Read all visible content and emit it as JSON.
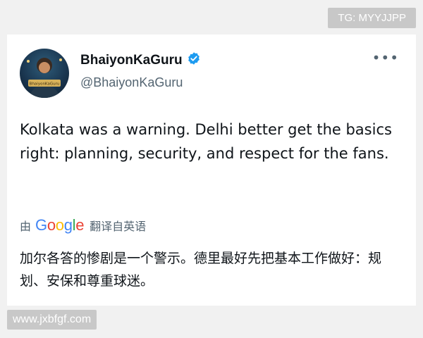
{
  "watermark_top": "TG: MYYJJPP",
  "watermark_bottom": "www.jxbfgf.com",
  "tweet": {
    "display_name": "BhaiyonKaGuru",
    "handle": "@BhaiyonKaGuru",
    "more_label": "•••",
    "text": "Kolkata was a warning. Delhi better get the basics right: planning, security, and respect for the fans.",
    "avatar_caption": "BhaiyonKaGuru"
  },
  "translation": {
    "by_label": "由",
    "provider": "Google",
    "action_label": "翻译自英语",
    "text": "加尔各答的惨剧是一个警示。德里最好先把基本工作做好：规划、安保和尊重球迷。"
  },
  "colors": {
    "text_primary": "#0f1419",
    "text_secondary": "#536471",
    "verified_blue": "#1d9bf0",
    "google_blue": "#4285F4",
    "google_red": "#EA4335",
    "google_yellow": "#FBBC05",
    "google_green": "#34A853"
  },
  "icons": {
    "verified": "verified-badge-icon",
    "more": "more-horizontal-icon"
  }
}
